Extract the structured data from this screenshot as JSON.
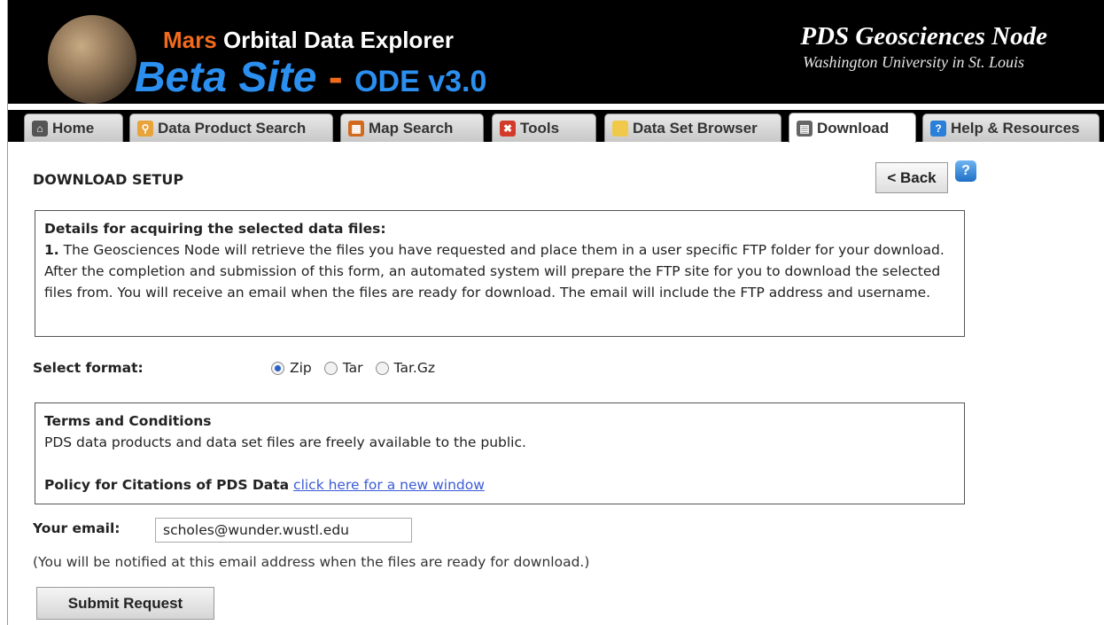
{
  "header": {
    "title_mars": "Mars",
    "title_rest": "Orbital Data Explorer",
    "beta": "Beta Site",
    "dash": "-",
    "version": "ODE v3.0",
    "node_name": "PDS Geosciences Node",
    "node_sub": "Washington University in St. Louis"
  },
  "tabs": [
    {
      "label": "Home",
      "icon": "home-icon",
      "color": "#555555"
    },
    {
      "label": "Data Product Search",
      "icon": "search-icon",
      "color": "#e8a33a"
    },
    {
      "label": "Map Search",
      "icon": "map-icon",
      "color": "#d26a1e"
    },
    {
      "label": "Tools",
      "icon": "tools-icon",
      "color": "#d43a2a"
    },
    {
      "label": "Data Set Browser",
      "icon": "folder-icon",
      "color": "#f0c94a"
    },
    {
      "label": "Download",
      "icon": "download-icon",
      "color": "#666666",
      "active": true
    },
    {
      "label": "Help & Resources",
      "icon": "help-icon",
      "color": "#2a7fd8"
    }
  ],
  "page": {
    "section_title": "DOWNLOAD SETUP",
    "back_label": "< Back",
    "help_glyph": "?"
  },
  "details": {
    "heading": "Details for acquiring the selected data files:",
    "step_num": "1.",
    "step_text": "The Geosciences Node will retrieve the files you have requested and place them in a user specific FTP folder for your download. After the completion and submission of this form, an automated system will prepare the FTP site for you to download the selected files from. You will receive an email when the files are ready for download. The email will include the FTP address and username."
  },
  "format": {
    "label": "Select format:",
    "options": [
      "Zip",
      "Tar",
      "Tar.Gz"
    ],
    "selected": "Zip"
  },
  "terms": {
    "heading": "Terms and Conditions",
    "text": "PDS data products and data set files are freely available to the public.",
    "policy_label": "Policy for Citations of PDS Data",
    "policy_link": "click here for a new window"
  },
  "email": {
    "label": "Your email:",
    "value": "scholes@wunder.wustl.edu",
    "notice": "(You will be notified at this email address when the files are ready for download.)"
  },
  "submit_label": "Submit Request"
}
